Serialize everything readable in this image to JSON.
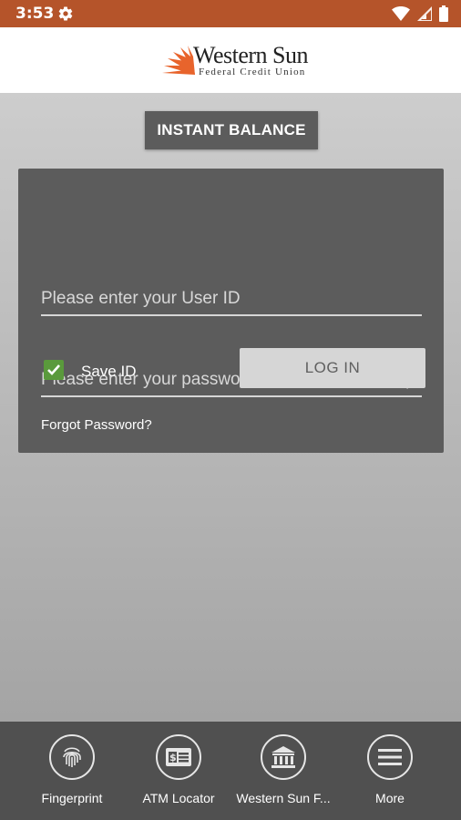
{
  "status_bar": {
    "time": "3:53",
    "icons": [
      "gear-icon",
      "wifi-icon",
      "signal-icon",
      "battery-icon"
    ],
    "color": "#b5542a"
  },
  "header": {
    "brand_name": "Western Sun",
    "brand_subtitle": "Federal Credit Union",
    "accent_color": "#e8642c"
  },
  "main": {
    "instant_balance_label": "INSTANT BALANCE",
    "login_form": {
      "user_id_placeholder": "Please enter your User ID",
      "password_placeholder": "Please enter your password",
      "save_id_label": "Save ID",
      "save_id_checked": true,
      "login_button_label": "LOG IN",
      "forgot_password_label": "Forgot Password?"
    }
  },
  "bottom_nav": {
    "items": [
      {
        "label": "Fingerprint",
        "icon": "fingerprint-icon"
      },
      {
        "label": "ATM Locator",
        "icon": "atm-icon"
      },
      {
        "label": "Western Sun F...",
        "icon": "bank-icon"
      },
      {
        "label": "More",
        "icon": "menu-icon"
      }
    ]
  }
}
